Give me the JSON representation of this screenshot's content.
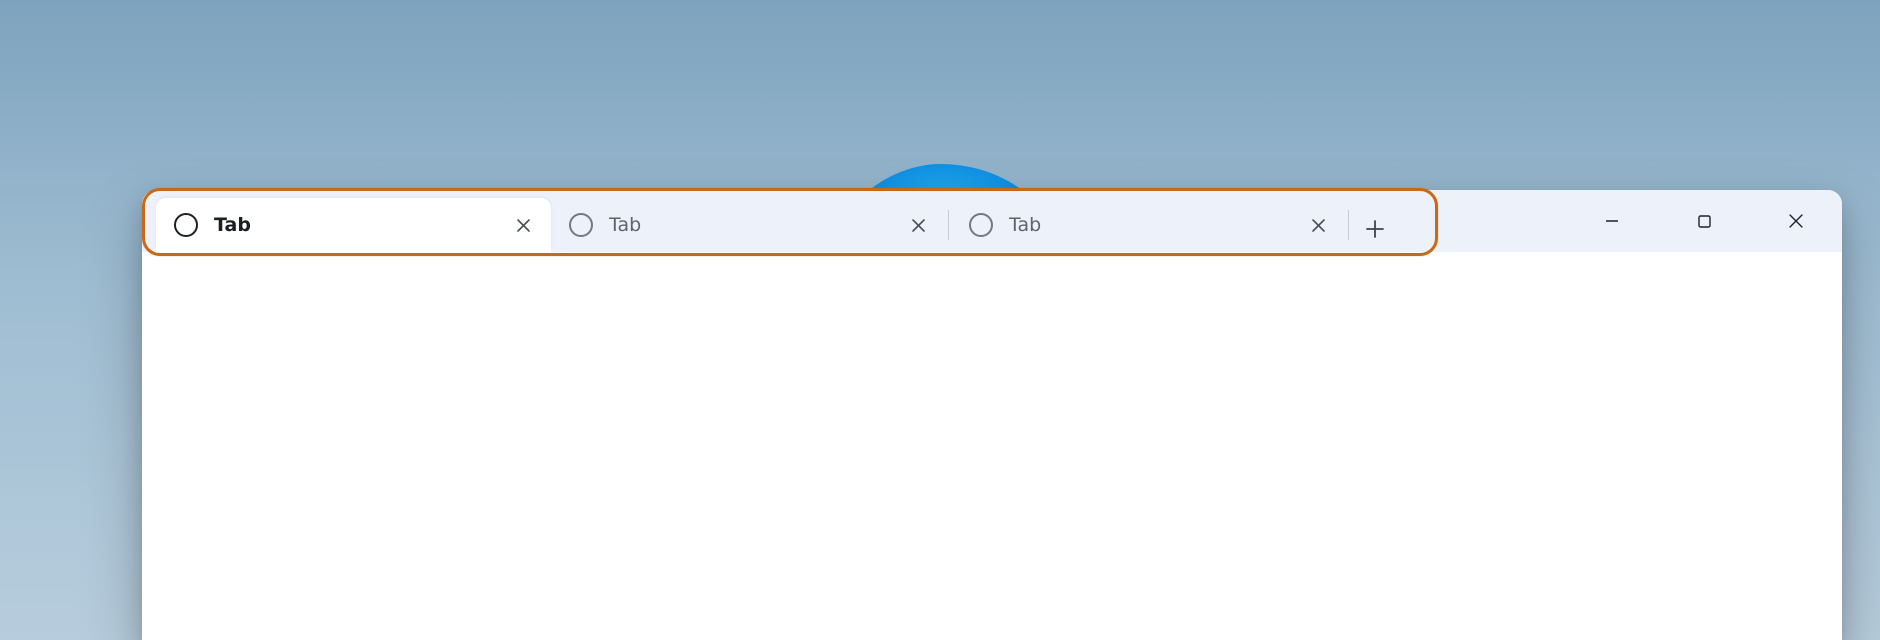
{
  "tabs": [
    {
      "label": "Tab",
      "active": true
    },
    {
      "label": "Tab",
      "active": false
    },
    {
      "label": "Tab",
      "active": false
    }
  ],
  "icons": {
    "close_tab": "×",
    "new_tab": "+",
    "minimize": "–",
    "maximize": "□",
    "close_window": "×"
  },
  "highlight_color": "#c86a15"
}
